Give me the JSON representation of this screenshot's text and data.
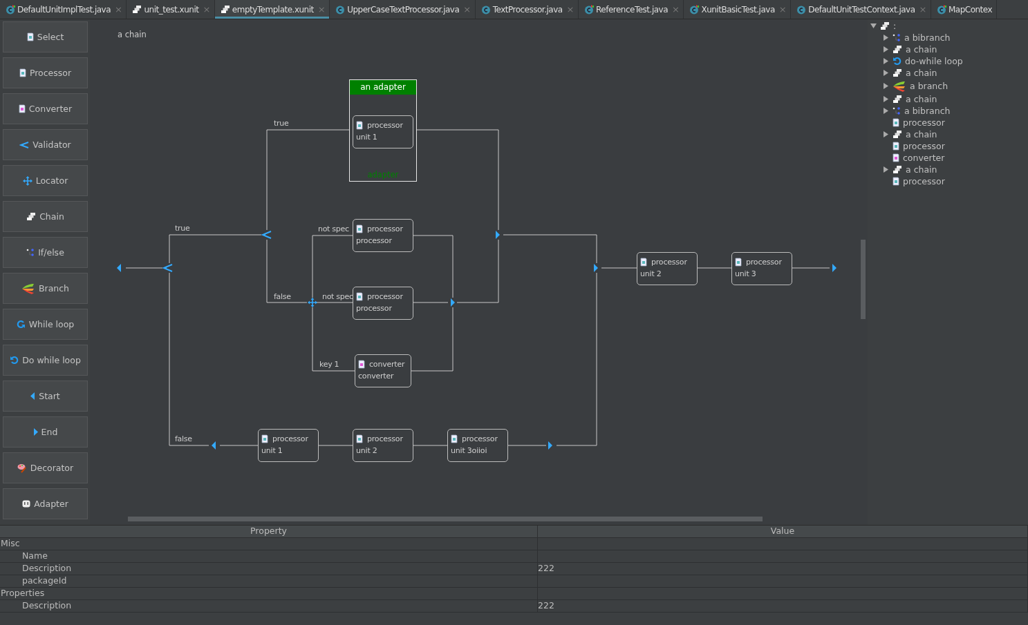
{
  "tabs": [
    {
      "label": "DefaultUnitImplTest.java",
      "kind": "java-test",
      "selected": false,
      "close": "×"
    },
    {
      "label": "unit_test.xunit",
      "kind": "chain",
      "selected": false,
      "close": "×"
    },
    {
      "label": "emptyTemplate.xunit",
      "kind": "chain",
      "selected": true,
      "close": "×"
    },
    {
      "label": "UpperCaseTextProcessor.java",
      "kind": "java",
      "selected": false,
      "close": "×"
    },
    {
      "label": "TextProcessor.java",
      "kind": "java",
      "selected": false,
      "close": "×"
    },
    {
      "label": "ReferenceTest.java",
      "kind": "java-test",
      "selected": false,
      "close": "×"
    },
    {
      "label": "XunitBasicTest.java",
      "kind": "java-test",
      "selected": false,
      "close": "×"
    },
    {
      "label": "DefaultUnitTestContext.java",
      "kind": "java",
      "selected": false,
      "close": "×"
    },
    {
      "label": "MapContex",
      "kind": "java-test",
      "selected": false
    }
  ],
  "palette": [
    {
      "label": "Select",
      "kind": "processor"
    },
    {
      "label": "Processor",
      "kind": "processor"
    },
    {
      "label": "Converter",
      "kind": "converter"
    },
    {
      "label": "Validator",
      "kind": "validator"
    },
    {
      "label": "Locator",
      "kind": "locator"
    },
    {
      "label": "Chain",
      "kind": "chain"
    },
    {
      "label": "If/else",
      "kind": "bibranch"
    },
    {
      "label": "Branch",
      "kind": "branch"
    },
    {
      "label": "While loop",
      "kind": "while"
    },
    {
      "label": "Do while loop",
      "kind": "dowhile"
    },
    {
      "label": "Start",
      "kind": "start"
    },
    {
      "label": "End",
      "kind": "end"
    },
    {
      "label": "Decorator",
      "kind": "decorator"
    },
    {
      "label": "Adapter",
      "kind": "adapter"
    }
  ],
  "diagram": {
    "title": "a chain",
    "adapter": {
      "title": "an adapter",
      "footer": "adapter"
    },
    "nodes": [
      {
        "kind": "processor",
        "type": "processor",
        "name": "unit 1"
      },
      {
        "kind": "processor",
        "type": "processor",
        "name": "processor"
      },
      {
        "kind": "processor",
        "type": "processor",
        "name": "processor"
      },
      {
        "kind": "converter",
        "type": "converter",
        "name": "converter"
      },
      {
        "kind": "processor",
        "type": "processor",
        "name": "unit 1"
      },
      {
        "kind": "processor",
        "type": "processor",
        "name": "unit 2"
      },
      {
        "kind": "processor",
        "type": "processor",
        "name": "unit 3oiioi"
      },
      {
        "kind": "processor",
        "type": "processor",
        "name": "unit 2"
      },
      {
        "kind": "processor",
        "type": "processor",
        "name": "unit 3"
      }
    ],
    "edge_labels": [
      "true",
      "true",
      "false",
      "false",
      "not spec",
      "not spec",
      "key 1"
    ]
  },
  "tree": {
    "label": ":",
    "kind": "chain",
    "expanded": true,
    "children": [
      {
        "label": "a bibranch",
        "kind": "bibranch",
        "expanded": false
      },
      {
        "label": "a chain",
        "kind": "chain",
        "expanded": false
      },
      {
        "label": "do-while loop",
        "kind": "dowhile",
        "expanded": false
      },
      {
        "label": "a chain",
        "kind": "chain",
        "expanded": false
      },
      {
        "label": "a branch",
        "kind": "branch",
        "expanded": false
      },
      {
        "label": "a chain",
        "kind": "chain",
        "expanded": false
      },
      {
        "label": "a bibranch",
        "kind": "bibranch",
        "expanded": false
      },
      {
        "label": "processor",
        "kind": "processor"
      },
      {
        "label": "a chain",
        "kind": "chain",
        "expanded": false
      },
      {
        "label": "processor",
        "kind": "processor"
      },
      {
        "label": "converter",
        "kind": "converter"
      },
      {
        "label": "a chain",
        "kind": "chain",
        "expanded": false
      },
      {
        "label": "processor",
        "kind": "processor"
      }
    ]
  },
  "properties": {
    "columns": [
      "Property",
      "Value"
    ],
    "groups": [
      {
        "name": "Misc",
        "rows": [
          {
            "name": "Name"
          },
          {
            "name": "Description",
            "value": "222"
          },
          {
            "name": "packageId"
          }
        ]
      },
      {
        "name": "Properties",
        "rows": [
          {
            "name": "Description",
            "value": "222"
          }
        ]
      }
    ]
  }
}
